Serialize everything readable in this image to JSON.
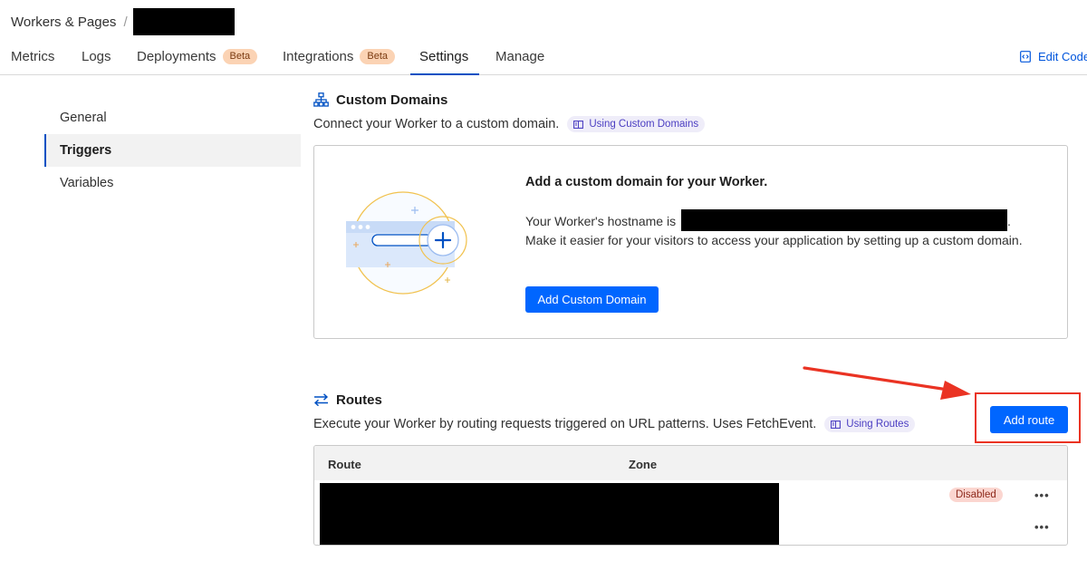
{
  "breadcrumb": {
    "root": "Workers & Pages",
    "separator": "/"
  },
  "tabs": [
    {
      "label": "Metrics"
    },
    {
      "label": "Logs"
    },
    {
      "label": "Deployments",
      "badge": "Beta"
    },
    {
      "label": "Integrations",
      "badge": "Beta"
    },
    {
      "label": "Settings",
      "active": true
    },
    {
      "label": "Manage"
    }
  ],
  "edit_code": {
    "label": "Edit Code",
    "icon": "code-file-icon"
  },
  "sidebar": {
    "items": [
      {
        "label": "General"
      },
      {
        "label": "Triggers",
        "active": true
      },
      {
        "label": "Variables"
      }
    ]
  },
  "custom_domains": {
    "title": "Custom Domains",
    "icon": "sitemap-icon",
    "description": "Connect your Worker to a custom domain.",
    "doc_link": "Using Custom Domains",
    "card": {
      "heading": "Add a custom domain for your Worker.",
      "hostname_prefix": "Your Worker's hostname is",
      "hostname_suffix": ".",
      "body": "Make it easier for your visitors to access your application by setting up a custom domain.",
      "button": "Add Custom Domain"
    }
  },
  "routes": {
    "title": "Routes",
    "icon": "swap-arrows-icon",
    "description": "Execute your Worker by routing requests triggered on URL patterns. Uses FetchEvent.",
    "doc_link": "Using Routes",
    "add_button": "Add route",
    "table": {
      "columns": [
        "Route",
        "Zone"
      ],
      "rows": [
        {
          "status": "Disabled",
          "menu": "•••"
        },
        {
          "status": "",
          "menu": "•••"
        }
      ]
    }
  },
  "colors": {
    "primary": "#0066ff",
    "link": "#0055dc",
    "active_indicator": "#0051c3",
    "beta_badge": "#fbd3b4",
    "disabled_badge": "#fbd6d0",
    "annotation": "#ea3323"
  }
}
